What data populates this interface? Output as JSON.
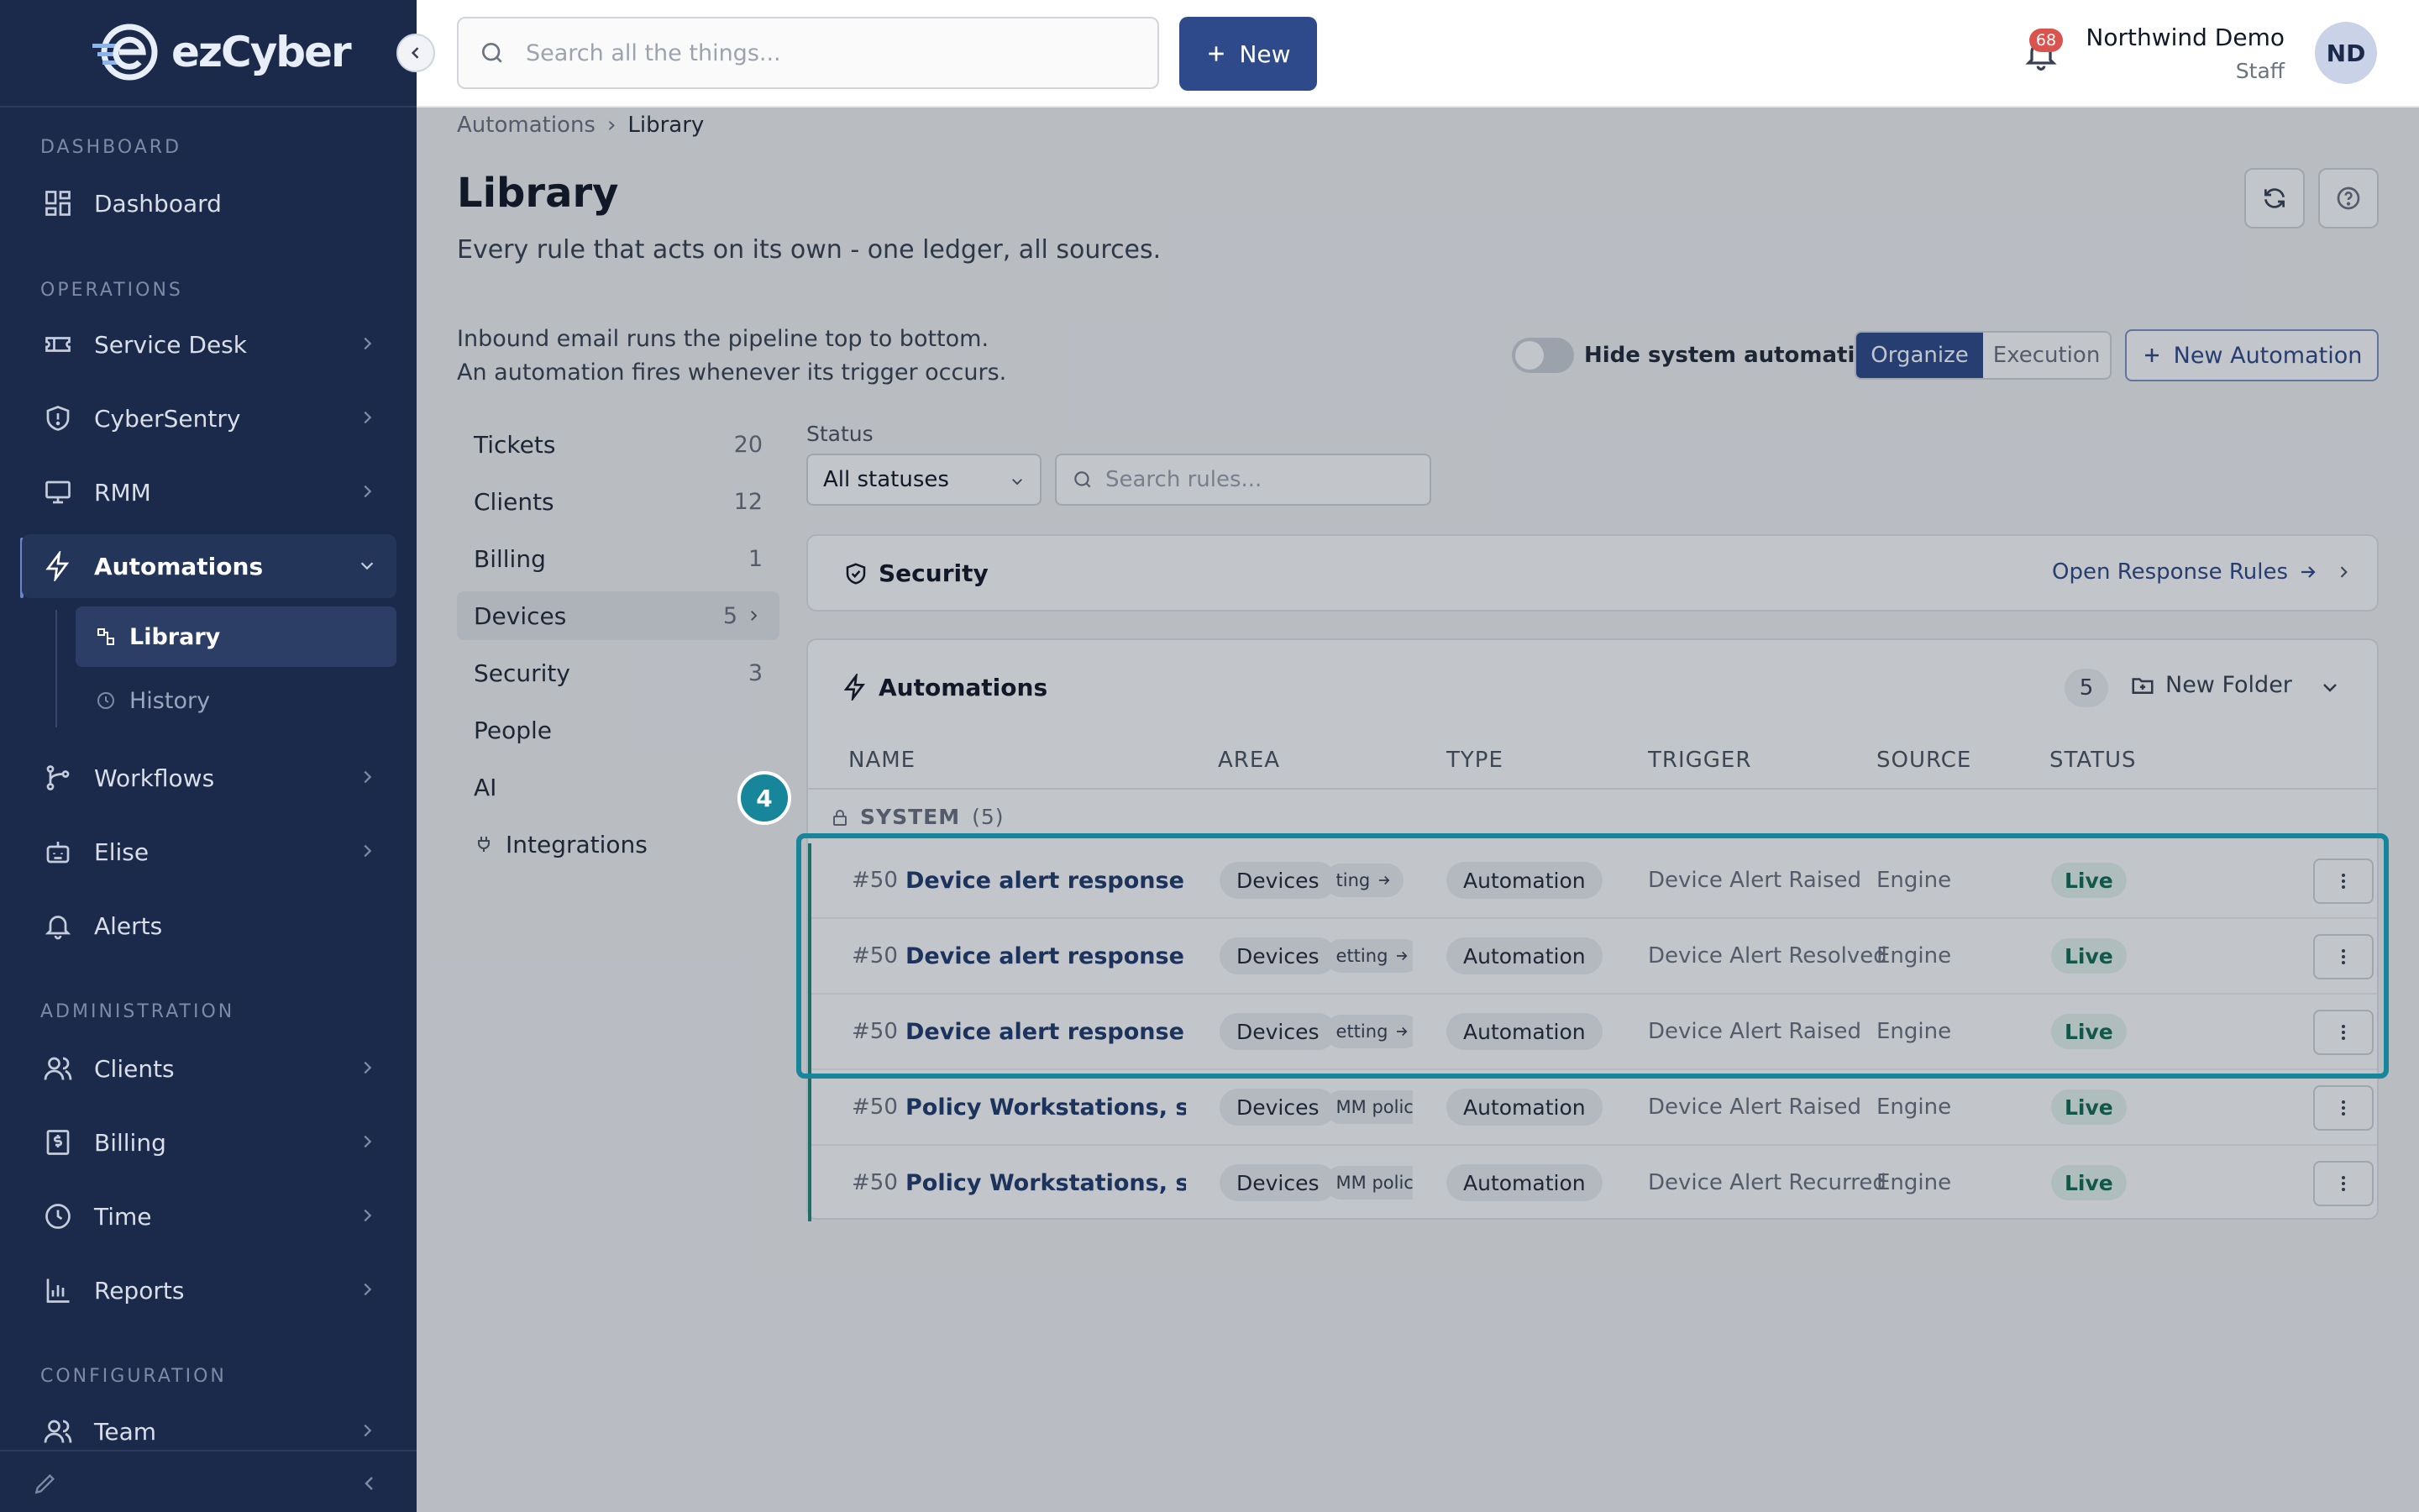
{
  "brand": {
    "name": "ezCyber"
  },
  "sidebar": {
    "sections": {
      "dashboard": "DASHBOARD",
      "operations": "OPERATIONS",
      "administration": "ADMINISTRATION",
      "configuration": "CONFIGURATION"
    },
    "items": {
      "dashboard": "Dashboard",
      "service_desk": "Service Desk",
      "cybersentry": "CyberSentry",
      "rmm": "RMM",
      "automations": "Automations",
      "library": "Library",
      "history": "History",
      "workflows": "Workflows",
      "elise": "Elise",
      "alerts": "Alerts",
      "clients": "Clients",
      "billing": "Billing",
      "time": "Time",
      "reports": "Reports",
      "team": "Team"
    }
  },
  "topbar": {
    "search_placeholder": "Search all the things...",
    "new_label": "New",
    "notification_count": "68",
    "user_name": "Northwind Demo",
    "user_role": "Staff",
    "avatar_initials": "ND"
  },
  "breadcrumb": {
    "parent": "Automations",
    "sep": "›",
    "current": "Library"
  },
  "page": {
    "title": "Library",
    "subtitle": "Every rule that acts on its own - one ledger, all sources.",
    "info_line1": "Inbound email runs the pipeline top to bottom.",
    "info_line2": "An automation fires whenever its trigger occurs."
  },
  "controls": {
    "hide_system": "Hide system automations",
    "organize": "Organize",
    "execution": "Execution",
    "new_automation": "New Automation",
    "status_label": "Status",
    "status_value": "All statuses",
    "search_rules_placeholder": "Search rules..."
  },
  "categories": [
    {
      "label": "Tickets",
      "count": "20"
    },
    {
      "label": "Clients",
      "count": "12"
    },
    {
      "label": "Billing",
      "count": "1"
    },
    {
      "label": "Devices",
      "count": "5"
    },
    {
      "label": "Security",
      "count": "3"
    },
    {
      "label": "People",
      "count": ""
    },
    {
      "label": "AI",
      "count": ""
    },
    {
      "label": "Integrations",
      "count": ""
    }
  ],
  "security_card": {
    "title": "Security",
    "link": "Open Response Rules"
  },
  "automations_card": {
    "title": "Automations",
    "count": "5",
    "new_folder": "New Folder",
    "columns": [
      "NAME",
      "AREA",
      "TYPE",
      "TRIGGER",
      "SOURCE",
      "STATUS"
    ],
    "group_label": "SYSTEM",
    "group_count": "(5)",
    "rows": [
      {
        "id": "#50",
        "name": "Device alert response - Critical",
        "area": "Devices",
        "sub": "ting",
        "type": "Automation",
        "trigger": "Device Alert Raised",
        "source": "Engine",
        "status": "Live"
      },
      {
        "id": "#50",
        "name": "Device alert response - ticket ...",
        "area": "Devices",
        "sub": "etting",
        "type": "Automation",
        "trigger": "Device Alert Resolved",
        "source": "Engine",
        "status": "Live"
      },
      {
        "id": "#50",
        "name": "Device alert response - Warni...",
        "area": "Devices",
        "sub": "etting",
        "type": "Automation",
        "trigger": "Device Alert Raised",
        "source": "Engine",
        "status": "Live"
      },
      {
        "id": "#50",
        "name": "Policy Workstations, standar...",
        "area": "Devices",
        "sub": "MM policy",
        "type": "Automation",
        "trigger": "Device Alert Raised",
        "source": "Engine",
        "status": "Live"
      },
      {
        "id": "#50",
        "name": "Policy Workstations, standar...",
        "area": "Devices",
        "sub": "MM policy",
        "type": "Automation",
        "trigger": "Device Alert Recurred",
        "source": "Engine",
        "status": "Live"
      }
    ]
  },
  "tour": {
    "step": "4"
  }
}
